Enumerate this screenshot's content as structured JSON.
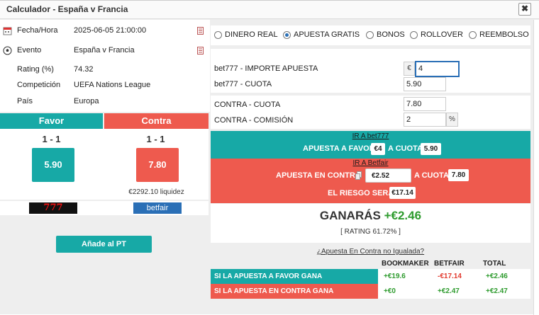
{
  "window": {
    "title": "Calculador - España v Francia",
    "close_label": "✖"
  },
  "event_info": [
    {
      "label": "Fecha/Hora",
      "value": "2025-06-05 21:00:00",
      "icon": "calendar-icon",
      "editable": true
    },
    {
      "label": "Evento",
      "value": "España v Francia",
      "icon": "soccer-ball-icon",
      "editable": true
    },
    {
      "label": "Rating (%)",
      "value": "74.32"
    },
    {
      "label": "Competición",
      "value": "UEFA Nations League"
    },
    {
      "label": "País",
      "value": "Europa"
    }
  ],
  "favor": {
    "header": "Favor",
    "score": "1 - 1",
    "odd": "5.90",
    "color": "#17a9a6",
    "bookmaker_logo": "777"
  },
  "contra": {
    "header": "Contra",
    "score": "1 - 1",
    "odd": "7.80",
    "liquidez": "€2292.10 liquidez",
    "color": "#ee5a4e",
    "exchange_logo": "betfair"
  },
  "add_button": "Añade al PT",
  "bet_types": [
    {
      "label": "DINERO REAL",
      "selected": false
    },
    {
      "label": "APUESTA GRATIS",
      "selected": true
    },
    {
      "label": "BONOS",
      "selected": false
    },
    {
      "label": "ROLLOVER",
      "selected": false
    },
    {
      "label": "REEMBOLSO",
      "selected": false
    }
  ],
  "form": {
    "stake_label": "bet777 - IMPORTE APUESTA",
    "currency": "€",
    "stake_value": "4",
    "odd_label": "bet777 - CUOTA",
    "odd_value": "5.90",
    "lay_odd_label": "CONTRA - CUOTA",
    "lay_odd_value": "7.80",
    "commission_label": "CONTRA - COMISIÓN",
    "commission_value": "2",
    "percent": "%"
  },
  "bookmaker_box": {
    "link": "IR A bet777",
    "text1": "APUESTA A FAVOR",
    "stake": "€4",
    "text2": "A CUOTA",
    "odd": "5.90"
  },
  "exchange_box": {
    "link": "IR A Betfair",
    "text1": "APUESTA EN CONTRA",
    "stake": "€2.52",
    "text2": "A CUOTA",
    "odd": "7.80",
    "risk_label": "EL RIESGO SERÁ",
    "risk": "€17.14"
  },
  "result": {
    "label": "GANARÁS",
    "profit": "+€2.46",
    "rating": "[ RATING 61.72% ]"
  },
  "unmatched_link": "¿Apuesta En Contra no Igualada?",
  "table": {
    "headers": [
      "BOOKMAKER",
      "BETFAIR",
      "TOTAL"
    ],
    "rows": [
      {
        "title": "SI LA APUESTA A FAVOR GANA",
        "bookmaker": "+€19.6",
        "betfair": "-€17.14",
        "total": "+€2.46"
      },
      {
        "title": "SI LA APUESTA EN CONTRA GANA",
        "bookmaker": "+€0",
        "betfair": "+€2.47",
        "total": "+€2.47"
      }
    ]
  }
}
